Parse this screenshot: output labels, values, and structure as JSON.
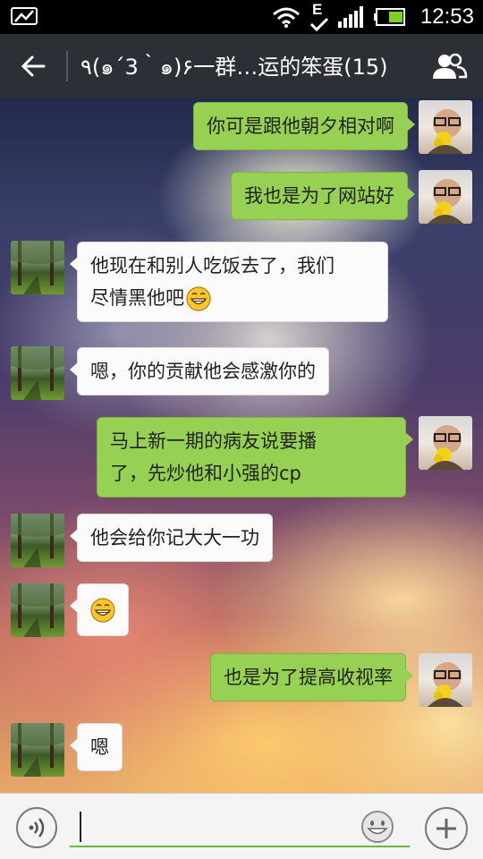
{
  "status_bar": {
    "time": "12:53",
    "network": "E",
    "icons": [
      "picture-icon",
      "wifi-icon",
      "network-type-icon",
      "signal-icon",
      "battery-icon"
    ]
  },
  "header": {
    "title": "٩(๑´3｀๑)۶一群…运的笨蛋(15)",
    "back_icon": "back-arrow-icon",
    "members_icon": "group-members-icon",
    "background": "#2c3036"
  },
  "messages": [
    {
      "side": "right",
      "text": "你可是跟他朝夕相对啊"
    },
    {
      "side": "right",
      "text": "我也是为了网站好"
    },
    {
      "side": "left",
      "lines": [
        "他现在和别人吃饭去了，我们",
        "尽情黑他吧"
      ],
      "emoji": "grin-emoji"
    },
    {
      "side": "left",
      "text": "嗯，你的贡献他会感激你的"
    },
    {
      "side": "right",
      "lines": [
        "马上新一期的病友说要播",
        "了，先炒他和小强的cp"
      ]
    },
    {
      "side": "left",
      "text": "他会给你记大大一功"
    },
    {
      "side": "left",
      "emoji": "grin-emoji"
    },
    {
      "side": "right",
      "text": "也是为了提高收视率"
    },
    {
      "side": "left",
      "text": "嗯"
    }
  ],
  "input_bar": {
    "value": "",
    "voice_icon": "voice-icon",
    "emoji_icon": "smiley-icon",
    "plus_icon": "plus-icon"
  },
  "colors": {
    "sent_bubble": "#97d153",
    "received_bubble": "#fbfbfb",
    "input_underline": "#6fb43a"
  }
}
